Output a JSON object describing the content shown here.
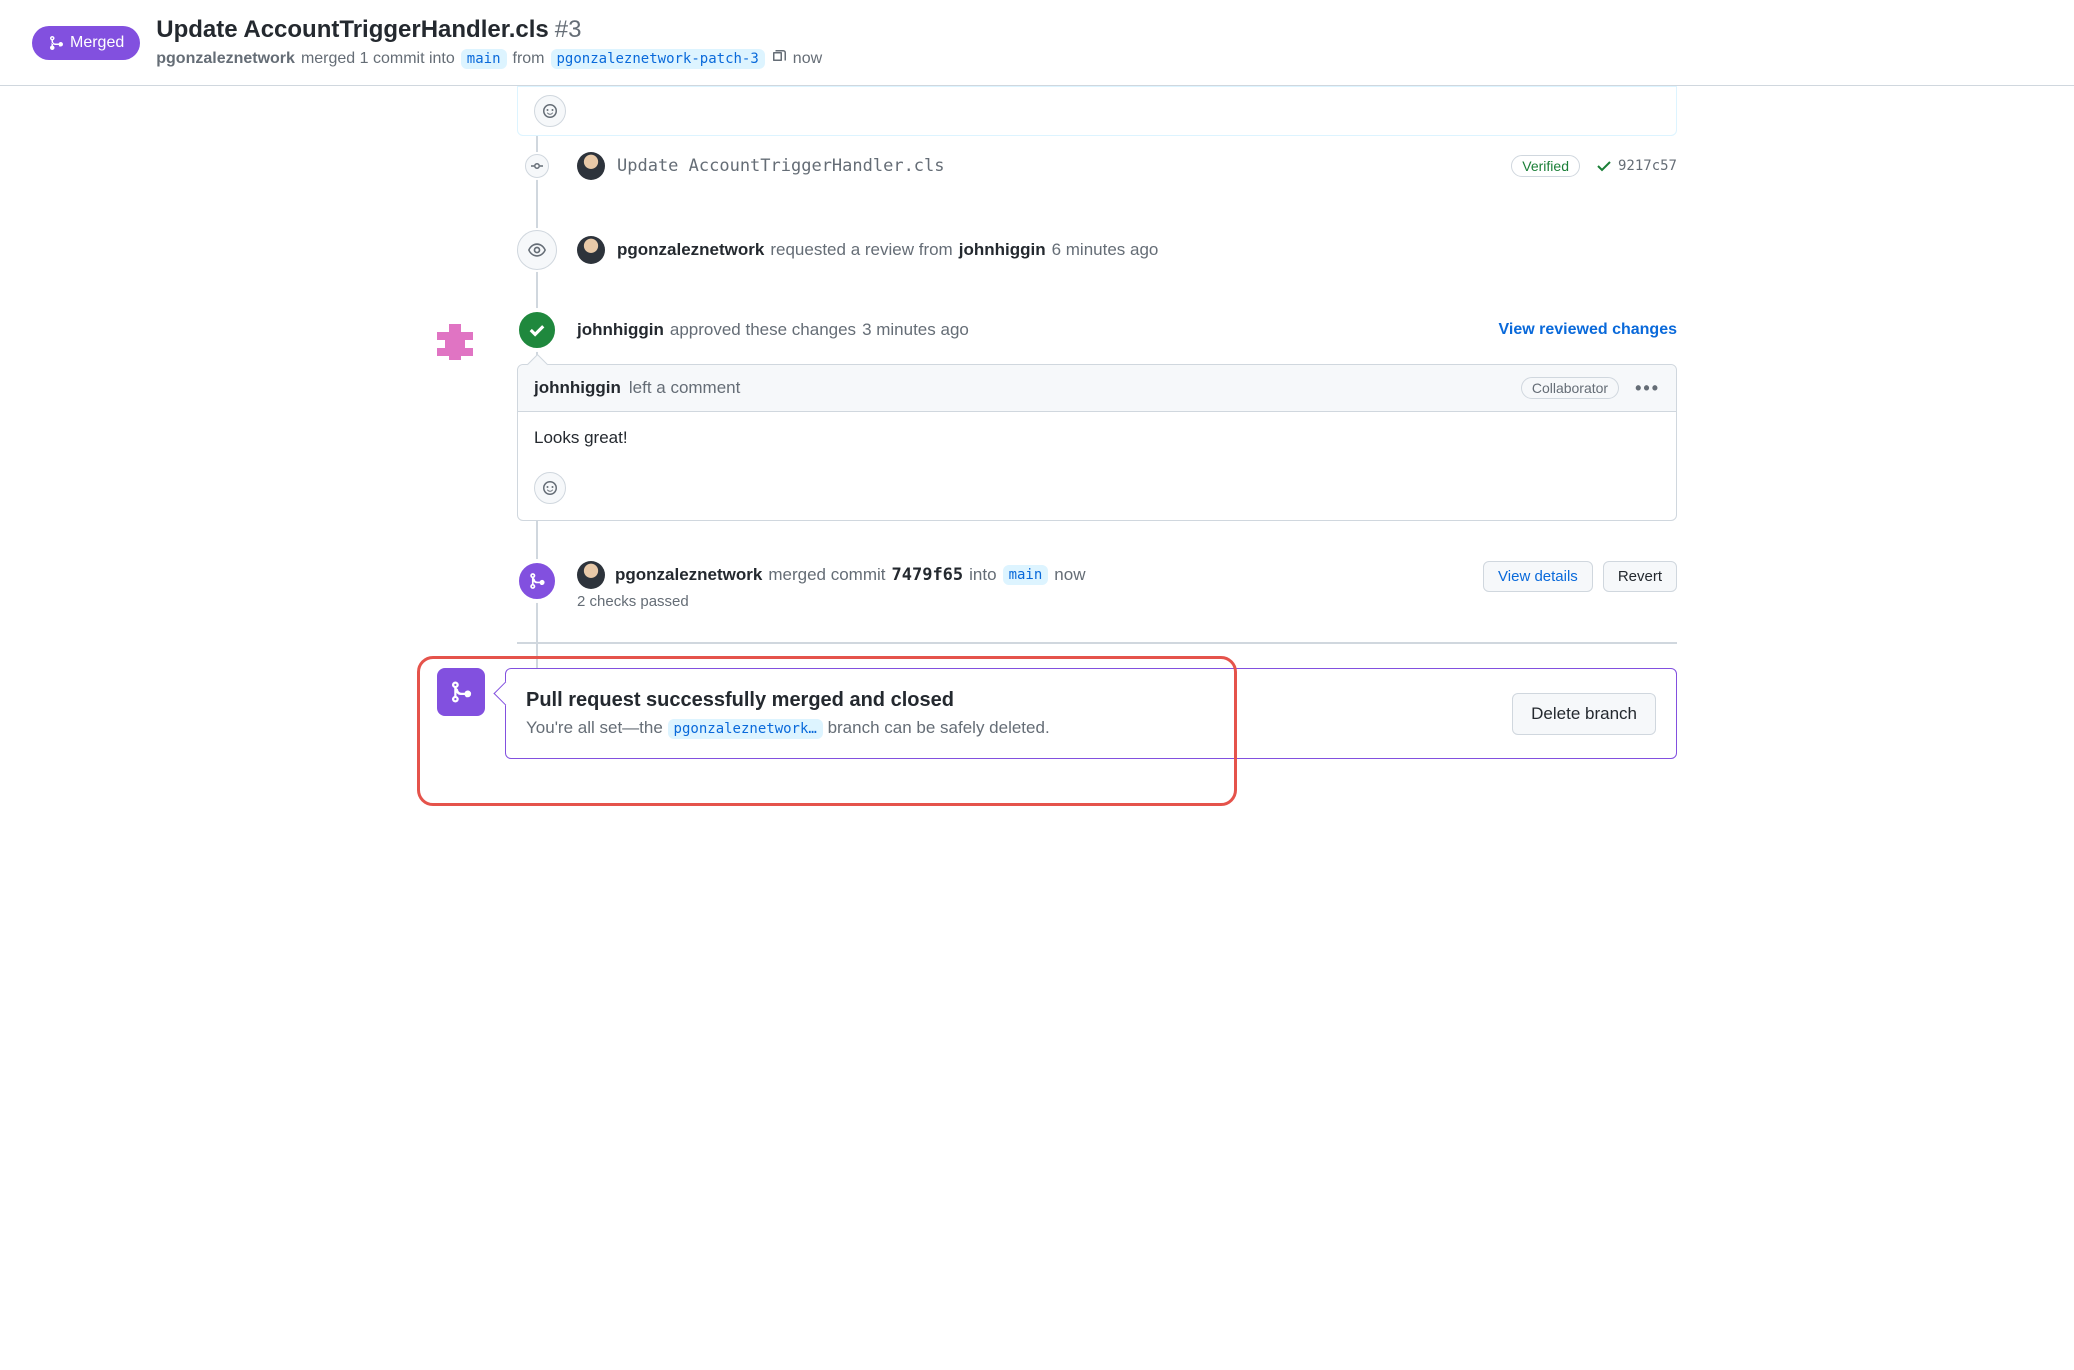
{
  "header": {
    "badge": "Merged",
    "title": "Update AccountTriggerHandler.cls",
    "pr_number": "#3",
    "author": "pgonzaleznetwork",
    "merged_text": "merged 1 commit into",
    "base_branch": "main",
    "from_text": "from",
    "head_branch": "pgonzaleznetwork-patch-3",
    "time": "now"
  },
  "commit": {
    "message": "Update AccountTriggerHandler.cls",
    "verified": "Verified",
    "sha": "9217c57"
  },
  "review_request": {
    "actor": "pgonzaleznetwork",
    "text": "requested a review from",
    "reviewer": "johnhiggin",
    "time": "6 minutes ago"
  },
  "approval": {
    "actor": "johnhiggin",
    "text": "approved these changes",
    "time": "3 minutes ago",
    "link": "View reviewed changes"
  },
  "comment": {
    "author": "johnhiggin",
    "action": "left a comment",
    "role": "Collaborator",
    "body": "Looks great!"
  },
  "merge_event": {
    "actor": "pgonzaleznetwork",
    "text": "merged commit",
    "sha": "7479f65",
    "into": "into",
    "branch": "main",
    "time": "now",
    "checks": "2 checks passed",
    "view_details": "View details",
    "revert": "Revert"
  },
  "success": {
    "title": "Pull request successfully merged and closed",
    "pre_text": "You're all set—the ",
    "branch": "pgonzaleznetwork…",
    "post_text": " branch can be safely deleted.",
    "delete_btn": "Delete branch"
  }
}
